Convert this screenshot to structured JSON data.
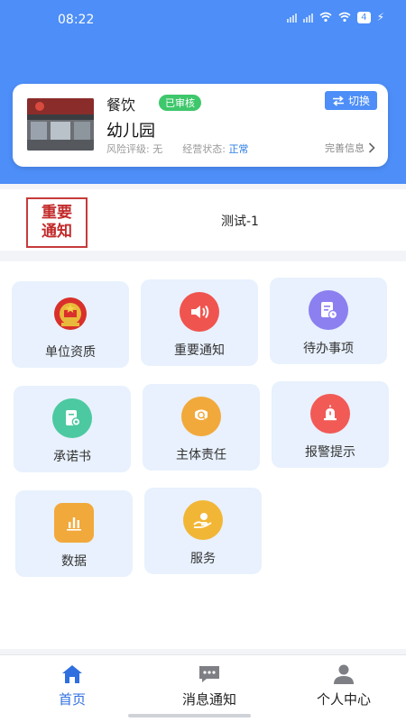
{
  "status_bar": {
    "time": "08:22",
    "battery": "4"
  },
  "unit_card": {
    "category": "餐饮",
    "badge": "已审核",
    "switch_label": "切换",
    "name": "幼儿园",
    "risk_label": "风险评级:",
    "risk_value": "无",
    "status_label": "经营状态:",
    "status_value": "正常",
    "more_label": "完善信息"
  },
  "notice": {
    "logo_line1": "重要",
    "logo_line2": "通知",
    "text": "测试-1"
  },
  "tiles": [
    {
      "label": "单位资质",
      "icon": "national-emblem-icon",
      "color": "#d9302b"
    },
    {
      "label": "重要通知",
      "icon": "speaker-icon",
      "color": "#f0544f"
    },
    {
      "label": "待办事项",
      "icon": "todo-document-icon",
      "color": "#8c7ff0"
    },
    {
      "label": "承诺书",
      "icon": "commitment-document-icon",
      "color": "#4cc9a0"
    },
    {
      "label": "主体责任",
      "icon": "responsibility-icon",
      "color": "#f2a93b"
    },
    {
      "label": "报警提示",
      "icon": "alarm-icon",
      "color": "#f25a56"
    },
    {
      "label": "数据",
      "icon": "data-chart-icon",
      "color": "#f2a93b"
    },
    {
      "label": "服务",
      "icon": "service-icon",
      "color": "#f2b636"
    }
  ],
  "nav": [
    {
      "label": "首页",
      "icon": "home-icon"
    },
    {
      "label": "消息通知",
      "icon": "message-icon"
    },
    {
      "label": "个人中心",
      "icon": "user-icon"
    }
  ],
  "colors": {
    "primary": "#4d8ef8",
    "success": "#3ec76b",
    "active_nav": "#2f6fe0"
  }
}
